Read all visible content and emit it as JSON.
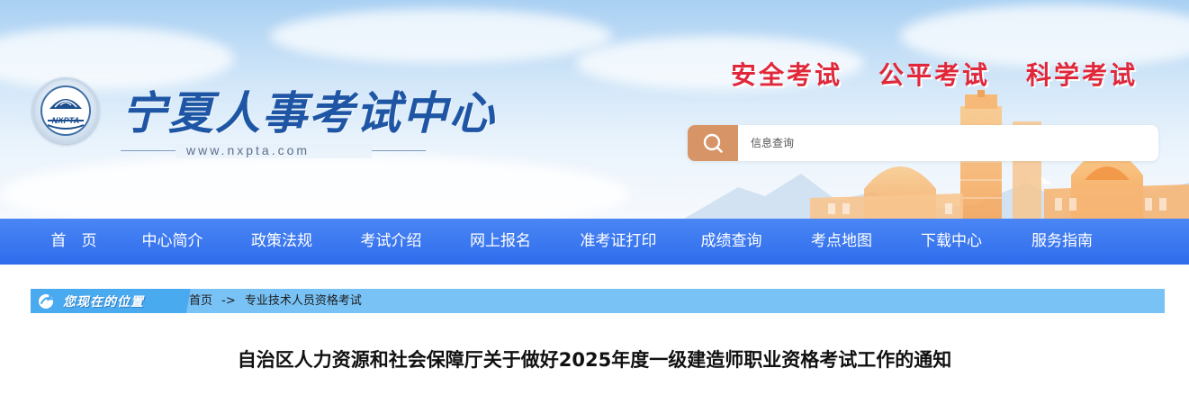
{
  "header": {
    "logo_abbr": "NXPTA",
    "site_name": "宁夏人事考试中心",
    "site_url": "www.nxpta.com",
    "slogans": [
      "安全考试",
      "公平考试",
      "科学考试"
    ],
    "colors": {
      "slogan": "#e0283a",
      "site_name": "#1e56a5",
      "search_button": "#d79466"
    },
    "search": {
      "placeholder": "信息查询",
      "icon": "search-icon"
    }
  },
  "nav": {
    "color": "#3874ef",
    "items": [
      "首　页",
      "中心简介",
      "政策法规",
      "考试介绍",
      "网上报名",
      "准考证打印",
      "成绩查询",
      "考点地图",
      "下载中心",
      "服务指南"
    ]
  },
  "breadcrumb": {
    "label": "您现在的位置",
    "icon": "location-arrow-icon",
    "home": "首页",
    "separator": "->",
    "current": "专业技术人员资格考试"
  },
  "article": {
    "title": "自治区人力资源和社会保障厅关于做好2025年度一级建造师职业资格考试工作的通知"
  }
}
